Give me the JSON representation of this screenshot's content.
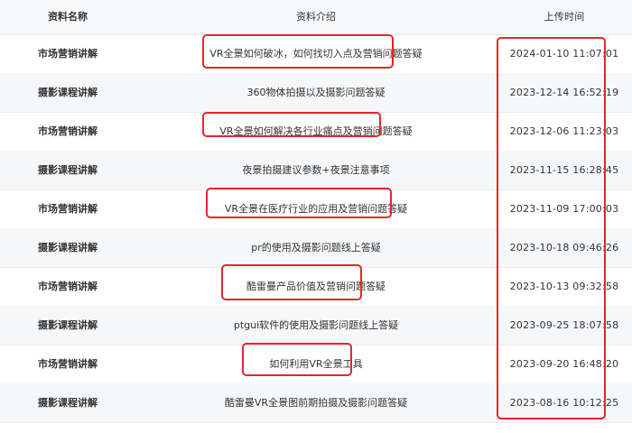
{
  "header": {
    "col_name": "资料名称",
    "col_intro": "资料介绍",
    "col_time": "上传时间"
  },
  "rows": [
    {
      "name": "市场营销讲解",
      "intro": "VR全景如何破冰，如何找切入点及营销问题答疑",
      "time": "2024-01-10 11:07:01"
    },
    {
      "name": "摄影课程讲解",
      "intro": "360物体拍摄以及摄影问题答疑",
      "time": "2023-12-14 16:52:19"
    },
    {
      "name": "市场营销讲解",
      "intro": "VR全景如何解决各行业痛点及营销问题答疑",
      "time": "2023-12-06 11:23:03"
    },
    {
      "name": "摄影课程讲解",
      "intro": "夜景拍摄建议参数+夜景注意事项",
      "time": "2023-11-15 16:28:45"
    },
    {
      "name": "市场营销讲解",
      "intro": "VR全景在医疗行业的应用及营销问题答疑",
      "time": "2023-11-09 17:00:03"
    },
    {
      "name": "摄影课程讲解",
      "intro": "pr的使用及摄影问题线上答疑",
      "time": "2023-10-18 09:46:26"
    },
    {
      "name": "市场营销讲解",
      "intro": "酷雷曼产品价值及营销问题答疑",
      "time": "2023-10-13 09:32:58"
    },
    {
      "name": "摄影课程讲解",
      "intro": "ptgui软件的使用及摄影问题线上答疑",
      "time": "2023-09-25 18:07:58"
    },
    {
      "name": "市场营销讲解",
      "intro": "如何利用VR全景工具",
      "time": "2023-09-20 16:48:20"
    },
    {
      "name": "摄影课程讲解",
      "intro": "酷雷曼VR全景图前期拍摄及摄影问题答疑",
      "time": "2023-08-16 10:12:25"
    }
  ],
  "colors": {
    "highlight": "#e3262b",
    "header_bg": "#f7f8fa",
    "alt_row_bg": "#f6f7f9"
  }
}
